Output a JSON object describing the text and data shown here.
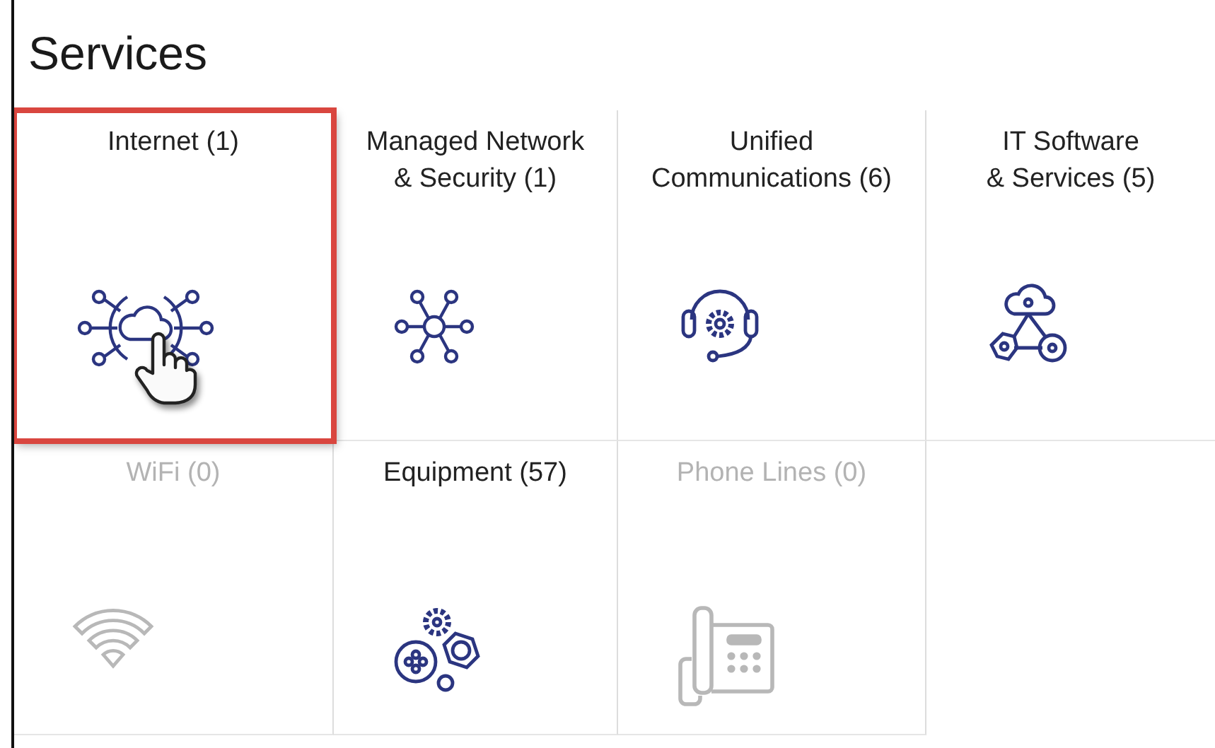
{
  "title": "Services",
  "tiles": [
    {
      "label": "Internet (1)",
      "kind": "cloud-network",
      "disabled": false,
      "selected": true
    },
    {
      "label": "Managed Network\n& Security (1)",
      "kind": "hub",
      "disabled": false,
      "selected": false
    },
    {
      "label": "Unified\nCommunications (6)",
      "kind": "headset",
      "disabled": false,
      "selected": false
    },
    {
      "label": "IT Software\n& Services (5)",
      "kind": "cloud-nuts",
      "disabled": false,
      "selected": false
    },
    {
      "label": "WiFi (0)",
      "kind": "wifi",
      "disabled": true,
      "selected": false
    },
    {
      "label": "Equipment (57)",
      "kind": "gears",
      "disabled": false,
      "selected": false
    },
    {
      "label": "Phone Lines (0)",
      "kind": "phone",
      "disabled": true,
      "selected": false
    }
  ]
}
